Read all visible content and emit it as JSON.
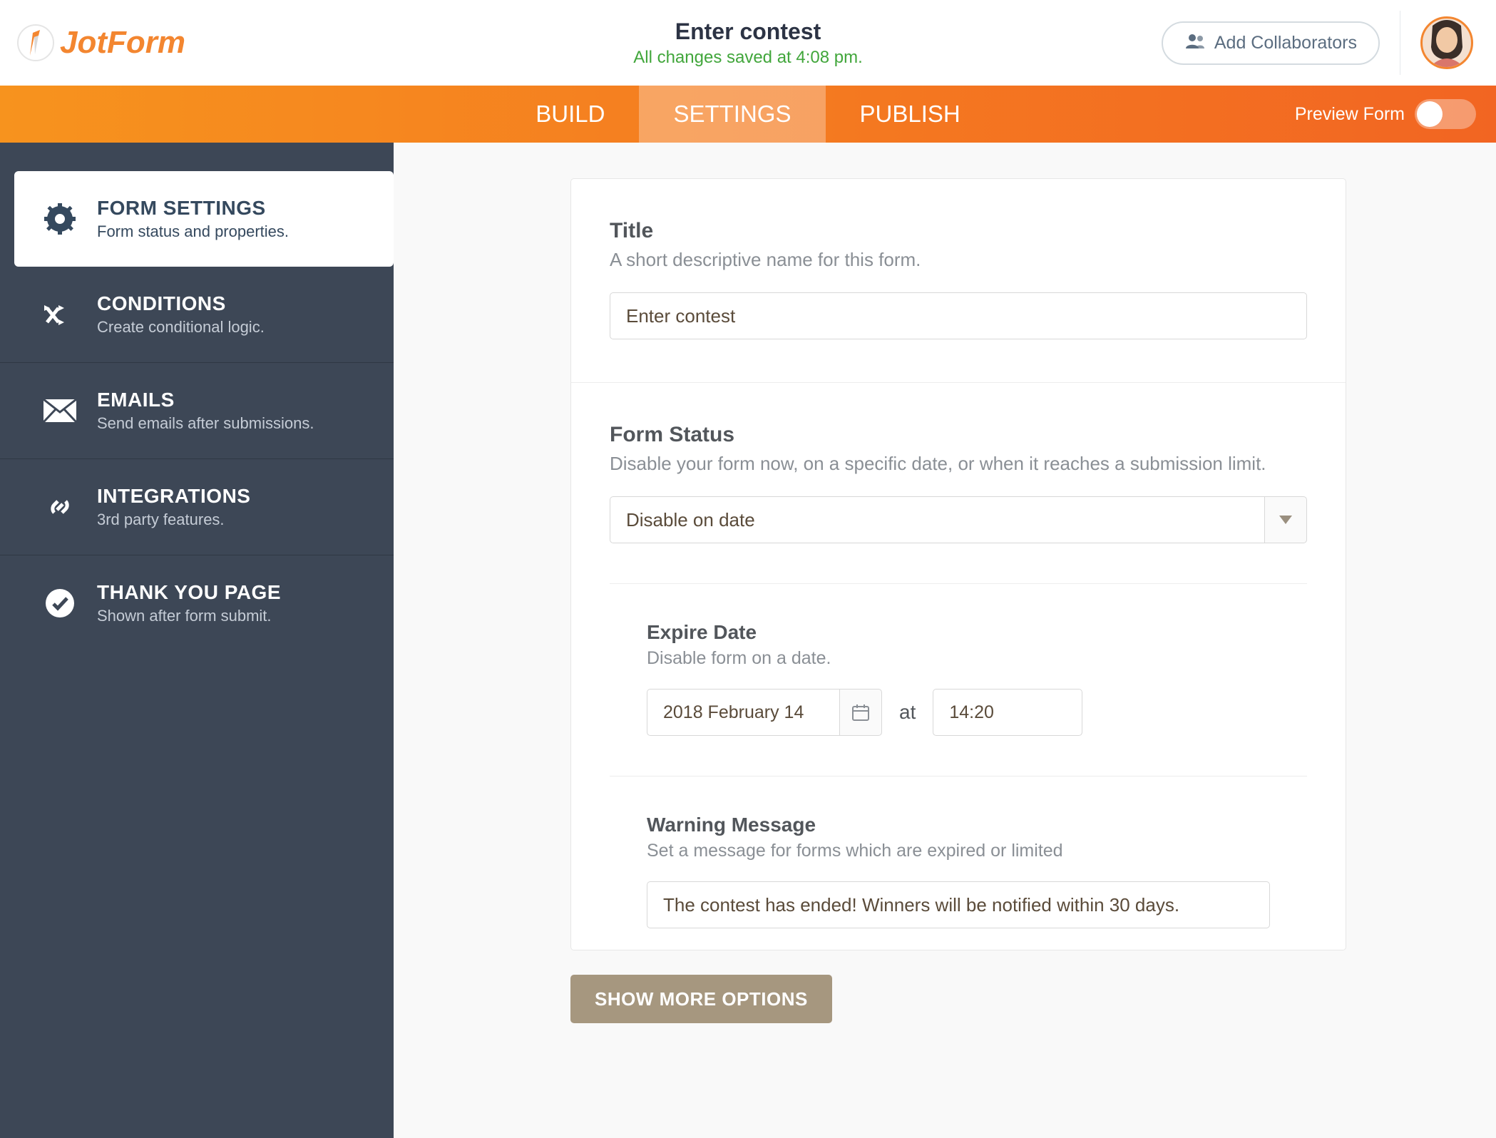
{
  "header": {
    "logo_text": "JotForm",
    "title": "Enter contest",
    "saved_text": "All changes saved at 4:08 pm.",
    "collab_label": "Add Collaborators"
  },
  "navbar": {
    "tabs": [
      "BUILD",
      "SETTINGS",
      "PUBLISH"
    ],
    "preview_label": "Preview Form"
  },
  "sidebar": {
    "items": [
      {
        "title": "FORM SETTINGS",
        "desc": "Form status and properties."
      },
      {
        "title": "CONDITIONS",
        "desc": "Create conditional logic."
      },
      {
        "title": "EMAILS",
        "desc": "Send emails after submissions."
      },
      {
        "title": "INTEGRATIONS",
        "desc": "3rd party features."
      },
      {
        "title": "THANK YOU PAGE",
        "desc": "Shown after form submit."
      }
    ]
  },
  "settings": {
    "title": {
      "label": "Title",
      "desc": "A short descriptive name for this form.",
      "value": "Enter contest"
    },
    "form_status": {
      "label": "Form Status",
      "desc": "Disable your form now, on a specific date, or when it reaches a submission limit.",
      "selected": "Disable on date"
    },
    "expire": {
      "label": "Expire Date",
      "desc": "Disable form on a date.",
      "date": "2018 February 14",
      "at": "at",
      "time": "14:20"
    },
    "warning": {
      "label": "Warning Message",
      "desc": "Set a message for forms which are expired or limited",
      "value": "The contest has ended! Winners will be notified within 30 days."
    },
    "show_more": "SHOW MORE OPTIONS"
  }
}
